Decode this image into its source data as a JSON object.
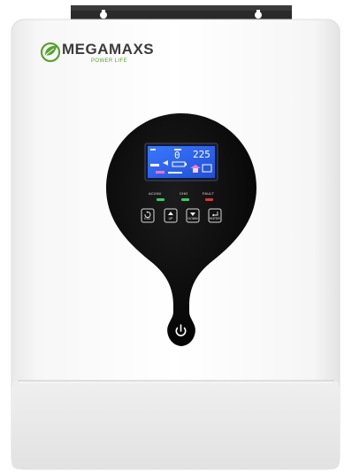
{
  "brand": {
    "name": "MEGAMAXS",
    "tagline": "POWER LIFE"
  },
  "lcd": {
    "left_reading": "0",
    "right_reading": "225"
  },
  "indicators": [
    {
      "label": "AC/INV",
      "color": "#2fd25a"
    },
    {
      "label": "CHG",
      "color": "#2fd25a"
    },
    {
      "label": "FAULT",
      "color": "#e8322e"
    }
  ],
  "buttons": [
    {
      "label": "ESC",
      "icon": "return-icon"
    },
    {
      "label": "UP",
      "icon": "arrow-up-icon"
    },
    {
      "label": "DOWN",
      "icon": "arrow-down-icon"
    },
    {
      "label": "ENTER",
      "icon": "enter-icon"
    }
  ],
  "colors": {
    "panel_black": "#0a0a0a",
    "lcd_blue": "#2f63f0",
    "brand_green": "#5aa12f"
  }
}
